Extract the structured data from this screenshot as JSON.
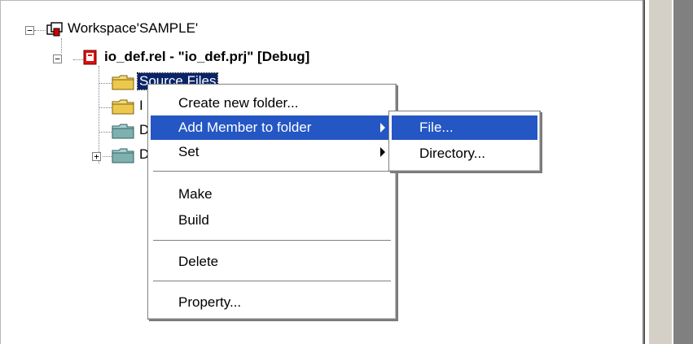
{
  "tree": {
    "workspace_label": "Workspace'SAMPLE'",
    "project_label": "io_def.rel - \"io_def.prj\" [Debug]",
    "folders": [
      {
        "label": "Source Files",
        "selected": true
      },
      {
        "label": "I",
        "selected": false
      },
      {
        "label": "D",
        "selected": false
      },
      {
        "label": "D",
        "selected": false
      }
    ]
  },
  "context_menu": {
    "items": [
      {
        "label": "Create new folder..."
      },
      {
        "label": "Add Member to folder",
        "submenu": true,
        "highlighted": true
      },
      {
        "label": "Set",
        "submenu": true
      },
      {
        "label": "Make"
      },
      {
        "label": "Build"
      },
      {
        "label": "Delete"
      },
      {
        "label": "Property..."
      }
    ]
  },
  "submenu": {
    "items": [
      {
        "label": "File...",
        "highlighted": true
      },
      {
        "label": "Directory..."
      }
    ]
  },
  "colors": {
    "highlight": "#2456c4",
    "folder_yellow": "#f3d36a",
    "folder_teal": "#7fb3b3",
    "project_red": "#cc0000"
  }
}
